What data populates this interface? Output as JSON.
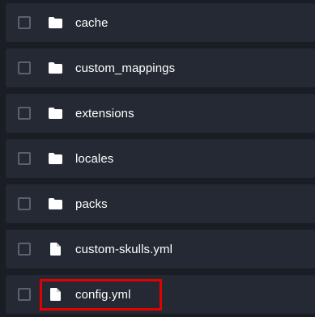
{
  "files": [
    {
      "name": "cache",
      "icon": "folder-icon",
      "type": "folder"
    },
    {
      "name": "custom_mappings",
      "icon": "folder-icon",
      "type": "folder"
    },
    {
      "name": "extensions",
      "icon": "folder-icon",
      "type": "folder"
    },
    {
      "name": "locales",
      "icon": "folder-icon",
      "type": "folder"
    },
    {
      "name": "packs",
      "icon": "folder-icon",
      "type": "folder"
    },
    {
      "name": "custom-skulls.yml",
      "icon": "file-icon",
      "type": "file"
    },
    {
      "name": "config.yml",
      "icon": "file-icon",
      "type": "file",
      "highlighted": true
    }
  ],
  "colors": {
    "background": "#1a1d24",
    "row": "#252934",
    "text": "#ffffff",
    "checkbox_border": "#5b6170",
    "highlight": "#e50000"
  }
}
